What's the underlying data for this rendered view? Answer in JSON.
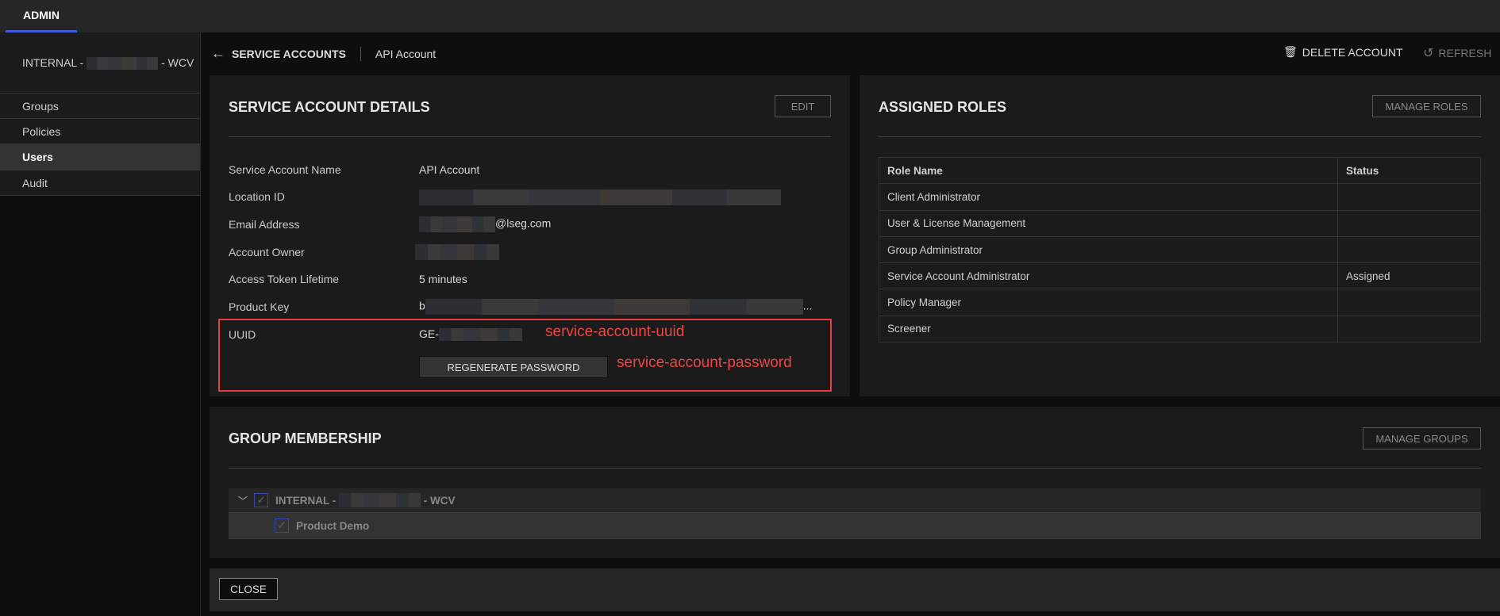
{
  "topbar": {
    "tab": "ADMIN",
    "accent": "#3b5bdb"
  },
  "sidebar": {
    "items": [
      {
        "label_prefix": "INTERNAL -",
        "label_suffix": "- WCV"
      },
      {
        "label": "Groups"
      },
      {
        "label": "Policies"
      },
      {
        "label": "Users"
      },
      {
        "label": "Audit"
      }
    ]
  },
  "header": {
    "back": "SERVICE ACCOUNTS",
    "current": "API Account",
    "delete": "DELETE ACCOUNT",
    "refresh": "REFRESH"
  },
  "details": {
    "title": "SERVICE ACCOUNT DETAILS",
    "edit": "EDIT",
    "rows": [
      {
        "label": "Service Account Name",
        "value": "API Account"
      },
      {
        "label": "Location ID",
        "value": ""
      },
      {
        "label": "Email Address",
        "value": "@lseg.com"
      },
      {
        "label": "Account Owner",
        "value": ""
      },
      {
        "label": "Access Token Lifetime",
        "value": "5 minutes"
      },
      {
        "label": "Product Key",
        "value": "b",
        "ellipsis": "..."
      },
      {
        "label": "UUID",
        "value": "GE-"
      }
    ],
    "regenerate": "REGENERATE PASSWORD",
    "annotations": {
      "uuid": "service-account-uuid",
      "password": "service-account-password"
    }
  },
  "roles": {
    "title": "ASSIGNED ROLES",
    "manage": "MANAGE ROLES",
    "headers": [
      "Role Name",
      "Status"
    ],
    "rows": [
      {
        "name": "Client Administrator",
        "status": ""
      },
      {
        "name": "User & License Management",
        "status": ""
      },
      {
        "name": "Group Administrator",
        "status": ""
      },
      {
        "name": "Service Account Administrator",
        "status": "Assigned"
      },
      {
        "name": "Policy Manager",
        "status": ""
      },
      {
        "name": "Screener",
        "status": ""
      }
    ]
  },
  "groups": {
    "title": "GROUP MEMBERSHIP",
    "manage": "MANAGE GROUPS",
    "parent_prefix": "INTERNAL -",
    "parent_suffix": "- WCV",
    "child": "Product Demo"
  },
  "footer": {
    "close": "CLOSE"
  }
}
